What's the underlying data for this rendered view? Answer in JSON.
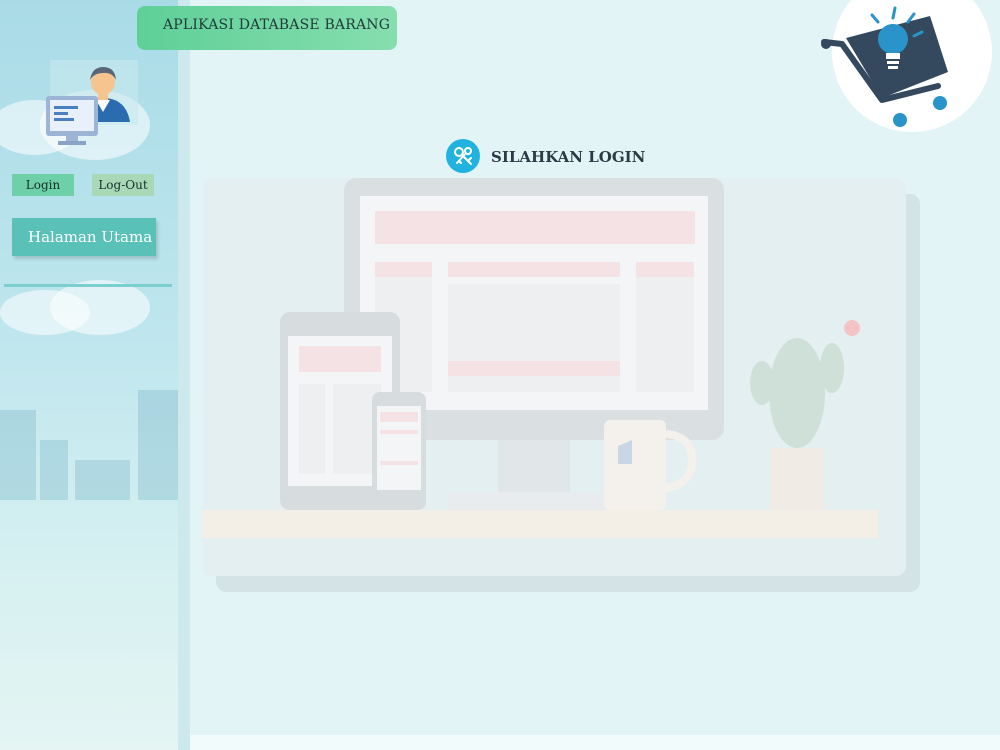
{
  "app": {
    "title": "APLIKASI DATABASE BARANG"
  },
  "sidebar": {
    "login_label": "Login",
    "logout_label": "Log-Out",
    "menu": [
      {
        "label": "Halaman Utama"
      }
    ]
  },
  "main": {
    "login_heading": "SILAHKAN LOGIN"
  },
  "icons": {
    "avatar": "admin-computer-icon",
    "logo": "shopping-cart-lightbulb-icon",
    "login": "keys-icon"
  },
  "colors": {
    "page_bg": "#e3f4f7",
    "title_bar": "#5fcf98",
    "login_button": "#6ed0a8",
    "logout_button": "#a8d8b6",
    "menu_button": "#59c1b7",
    "login_icon": "#22b2df",
    "logo_dark": "#34495e",
    "logo_blue": "#2a93c9"
  }
}
